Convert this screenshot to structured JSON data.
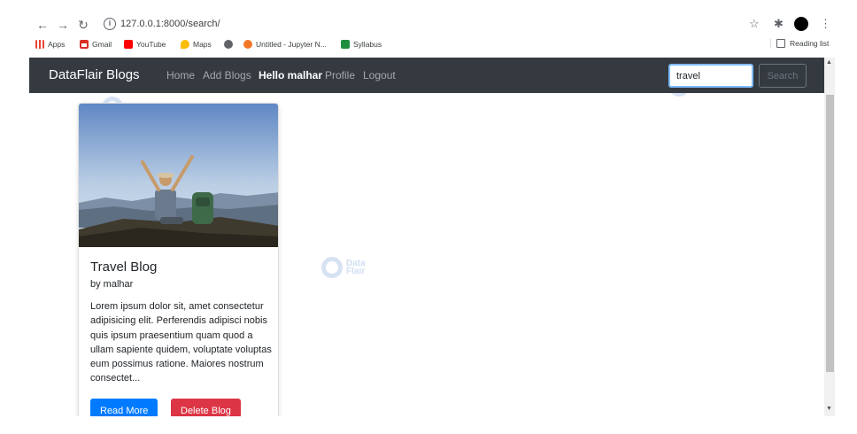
{
  "browser": {
    "url": "127.0.0.1:8000/search/",
    "bookmarks": [
      {
        "label": "Apps",
        "icon": "apps-grid-icon",
        "color": "#e8a33b"
      },
      {
        "label": "Gmail",
        "icon": "gmail-icon",
        "color": "#d93025"
      },
      {
        "label": "YouTube",
        "icon": "youtube-icon",
        "color": "#ff0000"
      },
      {
        "label": "Maps",
        "icon": "maps-icon",
        "color": "#fbbc04"
      },
      {
        "label": "",
        "icon": "globe-icon",
        "color": "#5f6368"
      },
      {
        "label": "Untitled - Jupyter N...",
        "icon": "jupyter-icon",
        "color": "#f37626"
      },
      {
        "label": "Syllabus",
        "icon": "classroom-icon",
        "color": "#1e8e3e"
      }
    ],
    "reading_list": "Reading list"
  },
  "navbar": {
    "brand": "DataFlair Blogs",
    "links": [
      "Home",
      "Add Blogs",
      "Hello malhar",
      "Profile",
      "Logout"
    ],
    "search_value": "travel",
    "search_button": "Search",
    "bg_color": "#343a40"
  },
  "card": {
    "title": "Travel Blog",
    "author": "by malhar",
    "text": "Lorem ipsum dolor sit, amet consectetur adipisicing elit. Perferendis adipisci nobis quis ipsum praesentium quam quod a ullam sapiente quidem, voluptate voluptas eum possimus ratione. Maiores nostrum consectet...",
    "read_more": "Read More",
    "delete": "Delete Blog"
  },
  "watermark": {
    "line1": "Data",
    "line2": "Flair"
  },
  "colors": {
    "primary": "#007bff",
    "danger": "#dc3545"
  }
}
